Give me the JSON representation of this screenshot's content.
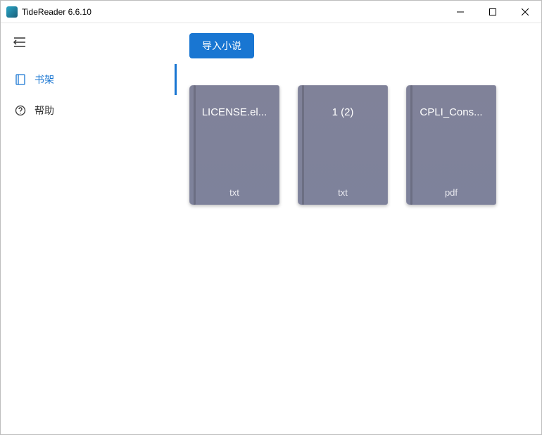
{
  "titlebar": {
    "title": "TideReader 6.6.10"
  },
  "sidebar": {
    "items": [
      {
        "label": "书架"
      },
      {
        "label": "帮助"
      }
    ]
  },
  "toolbar": {
    "import_label": "导入小说"
  },
  "books": [
    {
      "title": "LICENSE.el...",
      "ext": "txt"
    },
    {
      "title": "1 (2)",
      "ext": "txt"
    },
    {
      "title": "CPLI_Cons...",
      "ext": "pdf"
    }
  ]
}
